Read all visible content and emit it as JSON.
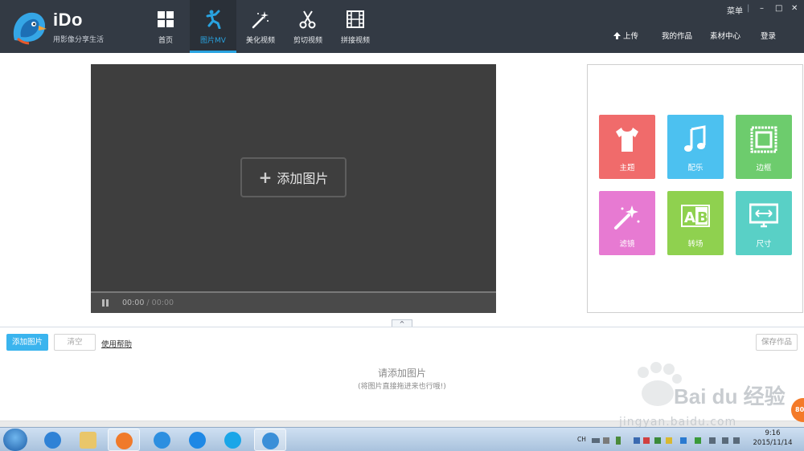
{
  "app": {
    "name": "iDo",
    "slogan": "用影像分享生活",
    "accent": "#29a3e0",
    "window_controls": {
      "menu": "菜单",
      "separator": "|",
      "minimize": "–",
      "restore": "□",
      "close": "✕"
    }
  },
  "nav": [
    {
      "label": "首页",
      "icon": "grid-icon"
    },
    {
      "label": "图片MV",
      "icon": "dancer-icon",
      "active": true
    },
    {
      "label": "美化视频",
      "icon": "magic-wand-icon"
    },
    {
      "label": "剪切视频",
      "icon": "scissors-icon"
    },
    {
      "label": "拼接视频",
      "icon": "film-strip-icon"
    }
  ],
  "top_right": {
    "upload": "上传",
    "my_works": "我的作品",
    "materials": "素材中心",
    "login": "登录"
  },
  "preview": {
    "add_button": "添加图片",
    "time_current": "00:00",
    "time_separator": "/",
    "time_total": "00:00",
    "progress": 0
  },
  "tools": [
    {
      "label": "主题",
      "icon": "tshirt-icon",
      "color": "#f06b6b"
    },
    {
      "label": "配乐",
      "icon": "music-note-icon",
      "color": "#4cc1f0"
    },
    {
      "label": "边框",
      "icon": "frame-icon",
      "color": "#6dcc6d"
    },
    {
      "label": "滤镜",
      "icon": "magic-wand-icon",
      "color": "#e77ad2"
    },
    {
      "label": "转场",
      "icon": "ab-transition-icon",
      "color": "#8fd14f"
    },
    {
      "label": "尺寸",
      "icon": "resize-screen-icon",
      "color": "#59d0c6"
    }
  ],
  "collapse_icon": "^",
  "bottom": {
    "add_images": "添加图片",
    "clear": "清空",
    "help": "使用帮助",
    "save": "保存作品",
    "empty_title": "请添加图片",
    "empty_hint": "(将图片直接拖进来也行哦!)"
  },
  "watermark": {
    "text": "Bai du 经验",
    "url": "jingyan.baidu.com",
    "badge": "80"
  },
  "taskbar": {
    "apps": [
      "internet-explorer-icon",
      "file-explorer-icon",
      "media-app-icon",
      "cloud-icon",
      "k-app-icon",
      "player-icon",
      "ido-icon"
    ],
    "input_lang": "CH",
    "time": "9:16",
    "date": "2015/11/14"
  }
}
